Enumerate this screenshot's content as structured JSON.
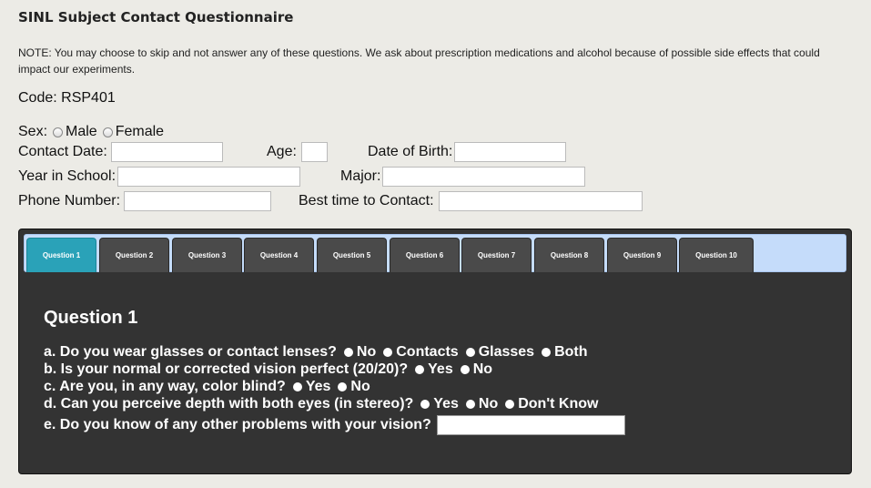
{
  "header": {
    "title": "SINL Subject Contact Questionnaire",
    "note": "NOTE: You may choose to skip and not answer any of these questions. We ask about prescription medications and alcohol because of possible side effects that could impact our experiments.",
    "code": "Code: RSP401"
  },
  "form": {
    "sex_label": "Sex:",
    "sex_options": [
      "Male",
      "Female"
    ],
    "contact_date_label": "Contact Date:",
    "age_label": "Age:",
    "dob_label": "Date of Birth:",
    "year_label": "Year in School:",
    "major_label": "Major:",
    "phone_label": "Phone Number:",
    "best_time_label": "Best time to Contact:"
  },
  "tabs": [
    "Question 1",
    "Question 2",
    "Question 3",
    "Question 4",
    "Question 5",
    "Question 6",
    "Question 7",
    "Question 8",
    "Question 9",
    "Question 10"
  ],
  "active_tab": "Question 1",
  "question": {
    "heading": "Question 1",
    "a": {
      "text": "a. Do you wear glasses or contact lenses?",
      "options": [
        "No",
        "Contacts",
        "Glasses",
        "Both"
      ]
    },
    "b": {
      "text": "b. Is your normal or corrected vision perfect (20/20)?",
      "options": [
        "Yes",
        "No"
      ]
    },
    "c": {
      "text": "c. Are you, in any way, color blind?",
      "options": [
        "Yes",
        "No"
      ]
    },
    "d": {
      "text": "d. Can you perceive depth with both eyes (in stereo)?",
      "options": [
        "Yes",
        "No",
        "Don't Know"
      ]
    },
    "e": {
      "text": "e. Do you know of any other problems with your vision?"
    }
  },
  "colors": {
    "active_tab": "#2aa2b8",
    "panel": "#333333",
    "tabbar": "#c5dcfa"
  }
}
